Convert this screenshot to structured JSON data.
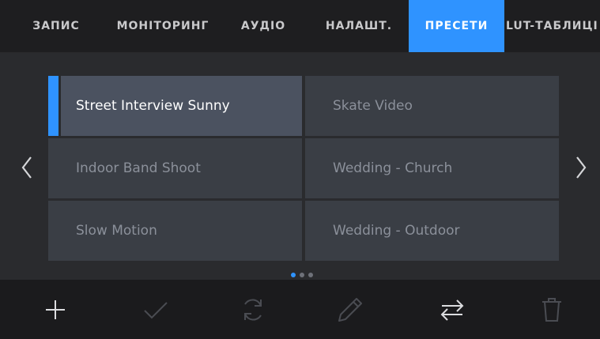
{
  "tabs": [
    {
      "label": "ЗАПИС",
      "active": false
    },
    {
      "label": "МОНІТОРИНГ",
      "active": false
    },
    {
      "label": "АУДІО",
      "active": false
    },
    {
      "label": "НАЛАШТ.",
      "active": false
    },
    {
      "label": "ПРЕСЕТИ",
      "active": true
    },
    {
      "label": "LUT-ТАБЛИЦІ",
      "active": false
    }
  ],
  "presets": [
    {
      "label": "Street Interview Sunny",
      "selected": true
    },
    {
      "label": "Skate Video",
      "selected": false
    },
    {
      "label": "Indoor Band Shoot",
      "selected": false
    },
    {
      "label": "Wedding  - Church",
      "selected": false
    },
    {
      "label": "Slow Motion",
      "selected": false
    },
    {
      "label": "Wedding - Outdoor",
      "selected": false
    }
  ],
  "pagination": {
    "pages": 3,
    "current": 1
  },
  "navigation": {
    "prev_icon": "chevron-left-icon",
    "next_icon": "chevron-right-icon"
  },
  "toolbar": {
    "items": [
      {
        "icon": "plus-icon",
        "enabled": true
      },
      {
        "icon": "checkmark-icon",
        "enabled": false
      },
      {
        "icon": "refresh-icon",
        "enabled": false
      },
      {
        "icon": "pencil-icon",
        "enabled": false
      },
      {
        "icon": "import-export-icon",
        "enabled": true
      },
      {
        "icon": "trash-icon",
        "enabled": false
      }
    ]
  },
  "colors": {
    "accent": "#2f93ff",
    "background": "#2a2b2e",
    "cell": "#3a3e45",
    "cell_selected": "#4b5260",
    "text_dim": "#8b909a"
  }
}
